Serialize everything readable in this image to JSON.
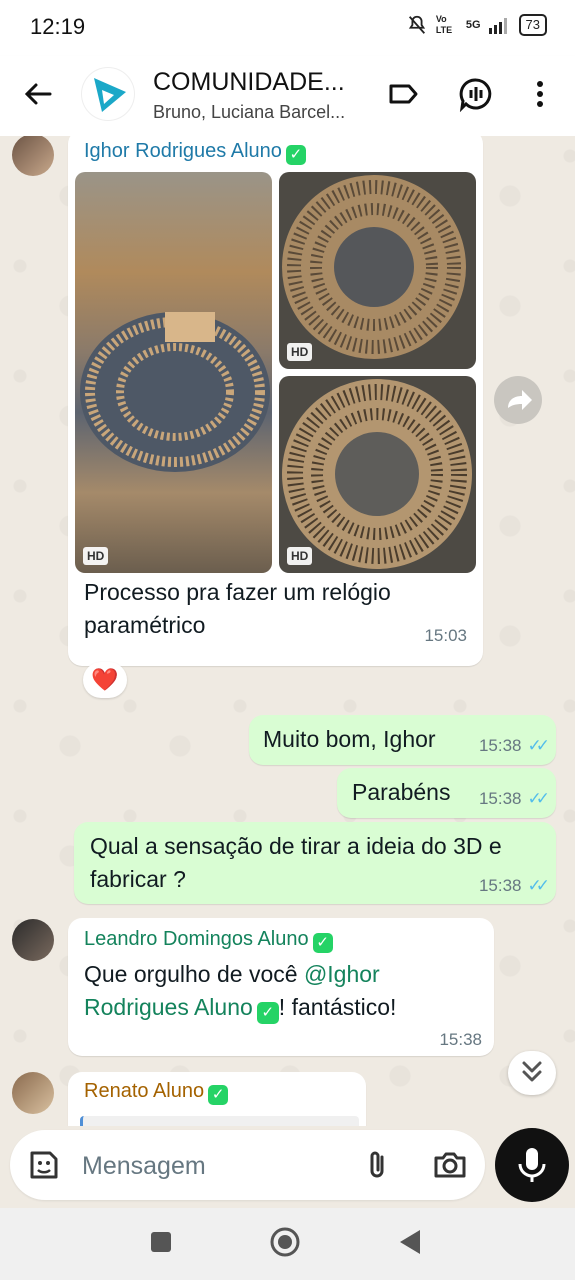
{
  "status_bar": {
    "time": "12:19",
    "network": "5G",
    "volte": "Vo LTE",
    "battery": "73"
  },
  "header": {
    "title": "COMUNIDADE...",
    "subtitle": "Bruno, Luciana Barcel..."
  },
  "messages": [
    {
      "sender": "Ighor Rodrigues Aluno",
      "verified": "✓",
      "images": [
        "HD",
        "HD",
        "HD"
      ],
      "text": "Processo pra fazer um relógio paramétrico",
      "time": "15:03",
      "reaction": "❤️"
    },
    {
      "text": "Muito bom, Ighor",
      "time": "15:38",
      "ticks": "✓✓"
    },
    {
      "text": "Parabéns",
      "time": "15:38",
      "ticks": "✓✓"
    },
    {
      "text": "Qual a sensação de tirar a ideia do 3D e fabricar ?",
      "time": "15:38",
      "ticks": "✓✓"
    },
    {
      "sender": "Leandro Domingos Aluno",
      "verified": "✓",
      "text_before": "Que orgulho de você ",
      "mention": "@Ighor Rodrigues Aluno",
      "mention_badge": "✓",
      "text_after": "! fantástico!",
      "time": "15:38"
    },
    {
      "sender": "Renato Aluno",
      "verified": "✓"
    }
  ],
  "composer": {
    "placeholder": "Mensagem"
  },
  "colors": {
    "incoming": "#ffffff",
    "outgoing": "#d9fdd3",
    "accent": "#25d366",
    "ticks": "#53bdeb"
  }
}
